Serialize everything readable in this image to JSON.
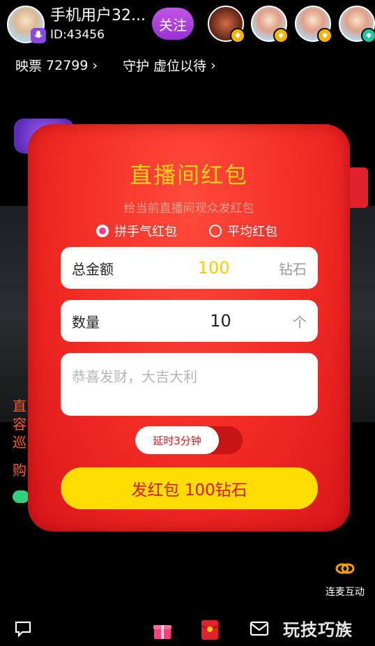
{
  "host": {
    "name": "手机用户32...",
    "id": "ID:43456",
    "follow_label": "关注"
  },
  "stats": {
    "tickets_label": "映票",
    "tickets_value": "72799",
    "guard_label": "守护",
    "guard_value": "虚位以待"
  },
  "side_texts": [
    "直",
    "容",
    "巡",
    "购"
  ],
  "modal": {
    "title": "直播间红包",
    "subtitle": "给当前直播间观众发红包",
    "radio_lucky": "拼手气红包",
    "radio_equal": "平均红包",
    "amount_label": "总金额",
    "amount_value": "100",
    "amount_unit": "钻石",
    "count_label": "数量",
    "count_value": "10",
    "count_unit": "个",
    "message_placeholder": "恭喜发财，大吉大利",
    "delay_label": "延时3分钟",
    "send_label": "发红包 100钻石"
  },
  "link_mic_label": "连麦互动",
  "watermark": "玩技巧族",
  "colors": {
    "accent_red": "#f22a24",
    "title_gold": "#ffd21a",
    "follow_purple": "#b042e0",
    "button_yellow": "#ffdd00"
  }
}
